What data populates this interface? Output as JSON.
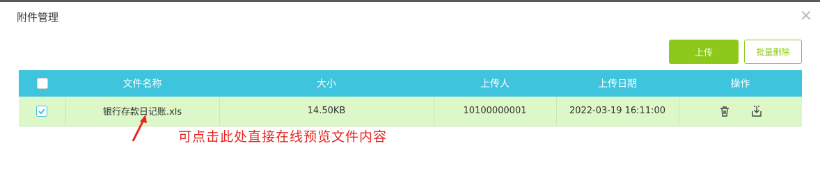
{
  "dialog": {
    "title": "附件管理",
    "close_symbol": "×"
  },
  "toolbar": {
    "upload_label": "上传",
    "batch_delete_label": "批量删除"
  },
  "table": {
    "headers": [
      "文件名称",
      "大小",
      "上传人",
      "上传日期",
      "操作"
    ],
    "rows": [
      {
        "checked": true,
        "file_name": "银行存款日记账.xls",
        "size": "14.50KB",
        "uploader": "10100000001",
        "date": "2022-03-19 16:11:00"
      }
    ]
  },
  "annotation": {
    "text": "可点击此处直接在线预览文件内容",
    "color": "#e8231f"
  },
  "colors": {
    "header": "#3ec4dc",
    "row": "#dcf7c8",
    "accent": "#8cc91a"
  },
  "icons": {
    "delete": "trash-icon",
    "download": "download-icon"
  }
}
